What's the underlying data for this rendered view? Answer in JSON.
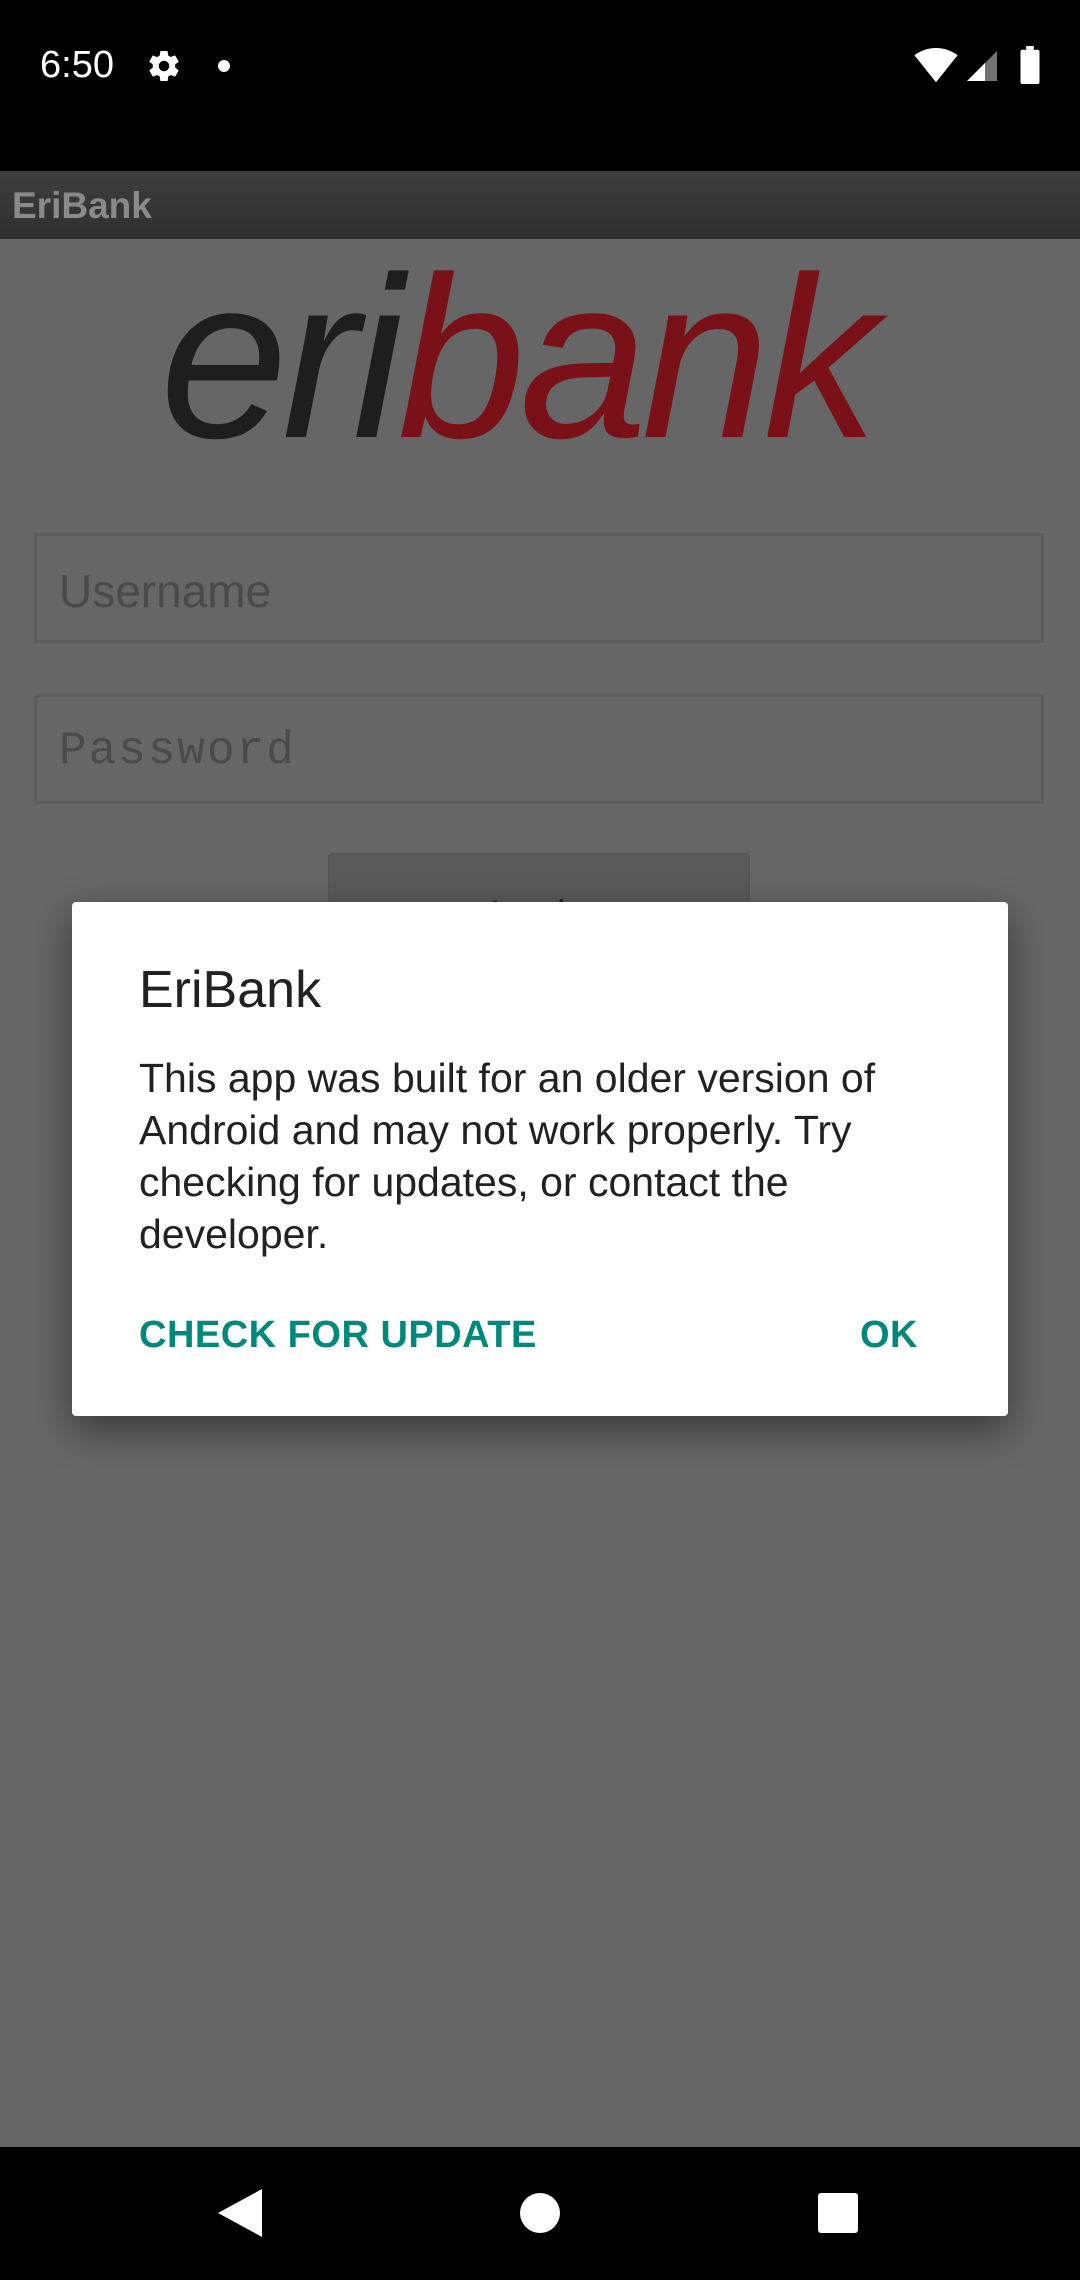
{
  "status_bar": {
    "time": "6:50",
    "icons": [
      "gear-icon",
      "dot-icon",
      "wifi-icon",
      "signal-icon",
      "battery-icon"
    ]
  },
  "app_bar": {
    "title": "EriBank"
  },
  "logo": {
    "part1": "eri",
    "part2": "bank",
    "color1": "#1e1e1e",
    "color2": "#7a1018"
  },
  "login_form": {
    "username_placeholder": "Username",
    "password_placeholder": "Password",
    "login_label": "Login"
  },
  "dialog": {
    "title": "EriBank",
    "message": "This app was built for an older version of Android and may not work properly. Try checking for updates, or contact the developer.",
    "check_update_label": "CHECK FOR UPDATE",
    "ok_label": "OK",
    "accent_color": "#00897b"
  },
  "nav_bar": {
    "icons": [
      "back-icon",
      "home-icon",
      "recents-icon"
    ]
  }
}
